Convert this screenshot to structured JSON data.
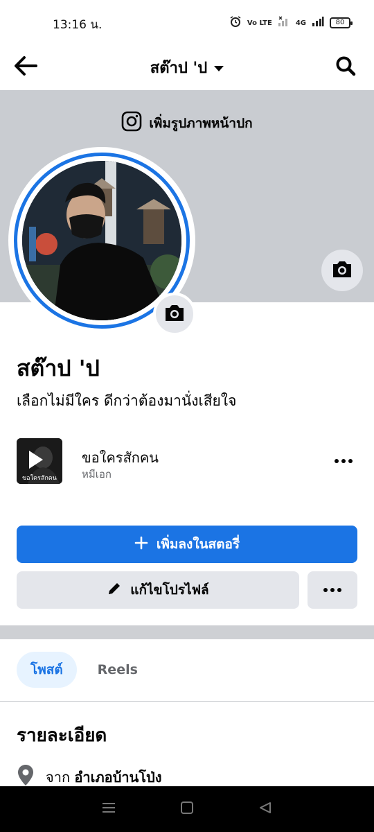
{
  "status_bar": {
    "time": "13:16 น.",
    "volte": "Vo LTE",
    "network": "4G",
    "battery": "80"
  },
  "header": {
    "title": "สต๊าป 'ป"
  },
  "cover": {
    "add_cover_label": "เพิ่มรูปภาพหน้าปก"
  },
  "profile": {
    "name": "สต๊าป 'ป",
    "bio": "เลือกไม่มีใคร ดีกว่าต้องมานั่งเสียใจ"
  },
  "music": {
    "title": "ขอใครสักคน",
    "artist": "หมีเอก",
    "thumb_caption": "ขอใครสักคน"
  },
  "actions": {
    "add_story_label": "เพิ่มลงในสตอรี่",
    "edit_profile_label": "แก้ไขโปรไฟล์"
  },
  "tabs": [
    {
      "label": "โพสต์",
      "active": true
    },
    {
      "label": "Reels",
      "active": false
    }
  ],
  "details": {
    "title": "รายละเอียด",
    "location_prefix": "จาก",
    "location_value": "อำเภอบ้านโป่ง"
  },
  "colors": {
    "accent": "#1b74e4",
    "cover_bg": "#c9ccd1",
    "button_gray": "#e4e6eb",
    "tab_active_bg": "#e7f3ff"
  }
}
